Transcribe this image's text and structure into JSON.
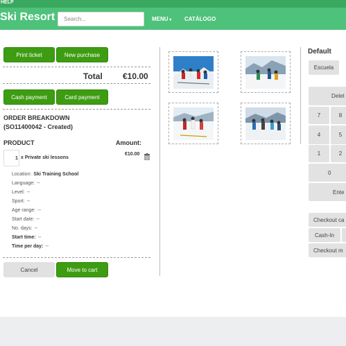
{
  "topbar": {
    "help": "HELP"
  },
  "navbar": {
    "brand": "Ski Resort",
    "search_placeholder": "Search...",
    "menu": "MENU",
    "catalog": "CATÁLOGO"
  },
  "ticket": {
    "print_ticket": "Print ticket",
    "new_purchase": "New purchase",
    "total_label": "Total",
    "total_value": "€10.00",
    "cash_payment": "Cash payment",
    "card_payment": "Card payment",
    "order_title": "ORDER BREAKDOWN",
    "order_id": "(SO11400042 - Created)",
    "product_header": "PRODUCT",
    "amount_header": "Amount:",
    "line": {
      "qty": "1",
      "name": "x Private ski lessons",
      "amount": "€10.00"
    },
    "details": [
      {
        "label": "Location:",
        "value": "Ski Training School",
        "strong": false
      },
      {
        "label": "Language:",
        "value": "--",
        "strong": false
      },
      {
        "label": "Level:",
        "value": "--",
        "strong": false
      },
      {
        "label": "Sport:",
        "value": "--",
        "strong": false
      },
      {
        "label": "Age range:",
        "value": "--",
        "strong": false
      },
      {
        "label": "Start date:",
        "value": "--",
        "strong": false
      },
      {
        "label": "No. days:",
        "value": "--",
        "strong": false
      },
      {
        "label": "Start time:",
        "value": "--",
        "strong": true
      },
      {
        "label": "Time per day:",
        "value": "--",
        "strong": true
      }
    ],
    "cancel": "Cancel",
    "move_to_cart": "Move to cart"
  },
  "right": {
    "default_label": "Default",
    "escuela": "Escuela",
    "delete": "Delet",
    "keys": [
      "7",
      "8",
      "4",
      "5",
      "1",
      "2",
      "0"
    ],
    "enter": "Ente",
    "checkout_ca": "Checkout ca",
    "cash_in": "Cash-In",
    "checkout_m": "Checkout m"
  },
  "colors": {
    "navbar": "#4ec27a",
    "topstrip": "#3aa85f",
    "button_green": "#3e9c12"
  }
}
